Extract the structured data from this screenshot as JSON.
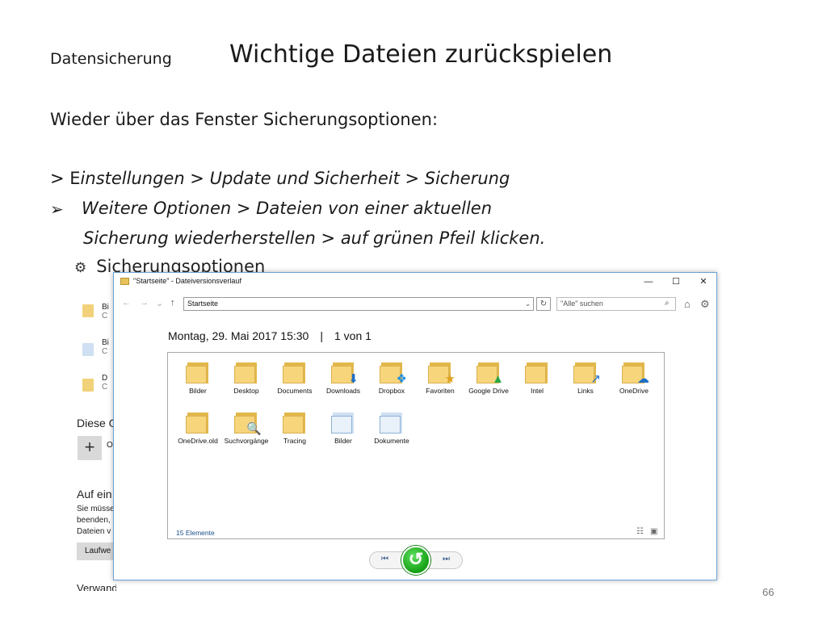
{
  "slide": {
    "section": "Datensicherung",
    "title": "Wichtige Dateien zurückspielen",
    "line1": "Wieder über das Fenster Sicherungsoptionen:",
    "line2_prefix": "> E",
    "line2_rest": "instellungen > Update und Sicherheit > Sicherung",
    "bullet_symbol": "➢",
    "line3": "Weitere Optionen >  Dateien von einer aktuellen",
    "line4": "Sicherung wiederherstellen > auf grünen Pfeil klicken.",
    "page_number": "66"
  },
  "background_settings": {
    "heading": "Sicherungsoptionen",
    "rows": [
      {
        "title": "Bi",
        "sub": "C"
      },
      {
        "title": "Bi",
        "sub": "C"
      },
      {
        "title": "D",
        "sub": "C"
      }
    ],
    "section_label": "Diese O",
    "plus_label": "+",
    "plus_text": "O",
    "section2_label": "Auf ein",
    "desc_lines": [
      "Sie müsse",
      "beenden,",
      "Dateien v"
    ],
    "button_label": "Laufwe",
    "footer_label": "Verwandte Einstellungen"
  },
  "window": {
    "title": "\"Startseite\" - Dateiversionsverlauf",
    "controls": {
      "minimize": "—",
      "maximize": "☐",
      "close": "✕"
    },
    "nav": {
      "back": "←",
      "forward": "→",
      "recent": "⌄",
      "up": "↑"
    },
    "address": "Startseite",
    "address_dropdown": "⌄",
    "refresh": "↻",
    "search_placeholder": "\"Alle\" suchen",
    "search_icon": "⌕",
    "home_icon": "⌂",
    "settings_icon": "⚙",
    "date": "Montag, 29. Mai 2017 15:30",
    "separator": "|",
    "version": "1 von 1",
    "items": [
      {
        "label": "Bilder",
        "icon": "pictures-folder-icon",
        "badge": ""
      },
      {
        "label": "Desktop",
        "icon": "desktop-folder-icon",
        "badge": ""
      },
      {
        "label": "Documents",
        "icon": "documents-folder-icon",
        "badge": ""
      },
      {
        "label": "Downloads",
        "icon": "downloads-folder-icon",
        "badge": "⬇"
      },
      {
        "label": "Dropbox",
        "icon": "dropbox-folder-icon",
        "badge": "❖"
      },
      {
        "label": "Favoriten",
        "icon": "favorites-folder-icon",
        "badge": "★"
      },
      {
        "label": "Google Drive",
        "icon": "google-drive-folder-icon",
        "badge": "▲"
      },
      {
        "label": "Intel",
        "icon": "folder-icon",
        "badge": ""
      },
      {
        "label": "Links",
        "icon": "links-folder-icon",
        "badge": "↗"
      },
      {
        "label": "OneDrive",
        "icon": "onedrive-folder-icon",
        "badge": "☁"
      },
      {
        "label": "OneDrive.old",
        "icon": "folder-icon",
        "badge": ""
      },
      {
        "label": "Suchvorgänge",
        "icon": "searches-folder-icon",
        "badge": "🔍"
      },
      {
        "label": "Tracing",
        "icon": "folder-icon",
        "badge": ""
      },
      {
        "label": "Bilder",
        "icon": "pictures-library-icon",
        "badge": ""
      },
      {
        "label": "Dokumente",
        "icon": "documents-library-icon",
        "badge": ""
      }
    ],
    "item_count": "15 Elemente",
    "view_details_icon": "☷",
    "view_icons_icon": "▣",
    "playback": {
      "previous": "⏮",
      "restore": "↺",
      "next": "⏭"
    }
  },
  "colors": {
    "window_border": "#6aa3d8",
    "restore_green": "#14a014",
    "folder": "#f7d57b"
  }
}
